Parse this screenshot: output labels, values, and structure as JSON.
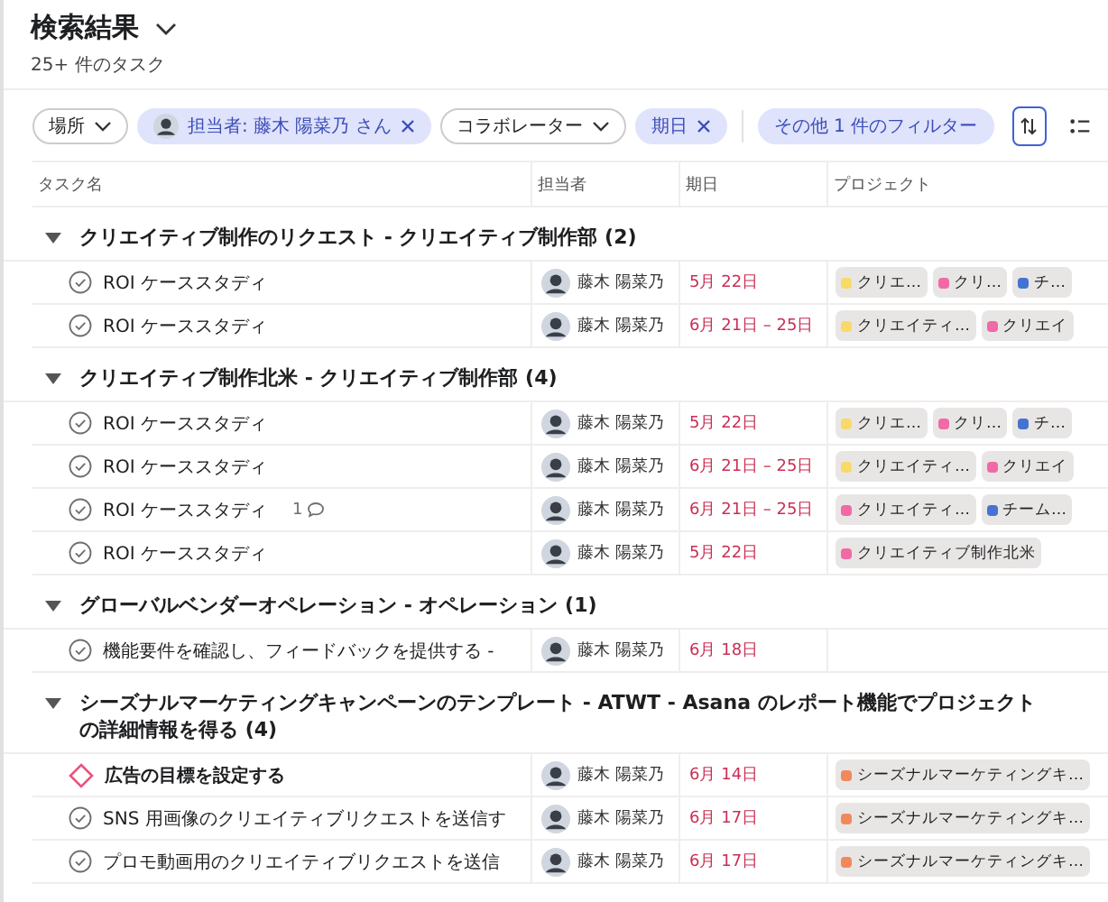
{
  "header": {
    "title": "検索結果",
    "subtitle": "25+ 件のタスク"
  },
  "filters": [
    {
      "kind": "dropdown",
      "label": "場所"
    },
    {
      "kind": "removable",
      "label": "担当者: 藤木 陽菜乃 さん",
      "avatar": true
    },
    {
      "kind": "dropdown",
      "label": "コラボレーター"
    },
    {
      "kind": "removable",
      "label": "期日",
      "avatar": false
    },
    {
      "kind": "more",
      "label": "その他 1 件のフィルター"
    }
  ],
  "columns": [
    "タスク名",
    "担当者",
    "期日",
    "プロジェクト"
  ],
  "sections": [
    {
      "title": "クリエイティブ制作のリクエスト - クリエイティブ制作部 (2)",
      "expanded": true,
      "rows": [
        {
          "kind": "task",
          "name": "ROI ケーススタディ",
          "assignee": "藤木 陽菜乃",
          "due": "5月 22日",
          "tags": [
            {
              "label": "クリエ…",
              "color": "#f8d96a"
            },
            {
              "label": "クリ…",
              "color": "#f06aa5"
            },
            {
              "label": "チ…",
              "color": "#4573d2"
            }
          ]
        },
        {
          "kind": "task",
          "name": "ROI ケーススタディ",
          "assignee": "藤木 陽菜乃",
          "due": "6月 21日 – 25日",
          "tags": [
            {
              "label": "クリエイティ…",
              "color": "#f8d96a"
            },
            {
              "label": "クリエイ",
              "color": "#f06aa5"
            }
          ]
        }
      ]
    },
    {
      "title": "クリエイティブ制作北米 - クリエイティブ制作部 (4)",
      "expanded": true,
      "rows": [
        {
          "kind": "task",
          "name": "ROI ケーススタディ",
          "assignee": "藤木 陽菜乃",
          "due": "5月 22日",
          "tags": [
            {
              "label": "クリエ…",
              "color": "#f8d96a"
            },
            {
              "label": "クリ…",
              "color": "#f06aa5"
            },
            {
              "label": "チ…",
              "color": "#4573d2"
            }
          ]
        },
        {
          "kind": "task",
          "name": "ROI ケーススタディ",
          "assignee": "藤木 陽菜乃",
          "due": "6月 21日 – 25日",
          "tags": [
            {
              "label": "クリエイティ…",
              "color": "#f8d96a"
            },
            {
              "label": "クリエイ",
              "color": "#f06aa5"
            }
          ]
        },
        {
          "kind": "task",
          "name": "ROI  ケーススタディ",
          "comments": "1",
          "assignee": "藤木 陽菜乃",
          "due": "6月 21日 – 25日",
          "tags": [
            {
              "label": "クリエイティ…",
              "color": "#f06aa5"
            },
            {
              "label": "チーム…",
              "color": "#4573d2"
            }
          ]
        },
        {
          "kind": "task",
          "name": "ROI  ケーススタディ",
          "assignee": "藤木 陽菜乃",
          "due": "5月 22日",
          "tags": [
            {
              "label": "クリエイティブ制作北米",
              "color": "#f06aa5"
            }
          ]
        }
      ]
    },
    {
      "title": "グローバルベンダーオペレーション - オペレーション (1)",
      "expanded": true,
      "rows": [
        {
          "kind": "task",
          "name": "機能要件を確認し、フィードバックを提供する -",
          "assignee": "藤木 陽菜乃",
          "due": "6月 18日",
          "tags": []
        }
      ]
    },
    {
      "title": "シーズナルマーケティングキャンペーンのテンプレート - ATWT - Asana のレポート機能でプロジェクトの詳細情報を得る (4)",
      "expanded": true,
      "rows": [
        {
          "kind": "milestone",
          "name": "広告の目標を設定する",
          "assignee": "藤木 陽菜乃",
          "due": "6月 14日",
          "tags": [
            {
              "label": "シーズナルマーケティングキ…",
              "color": "#f1895c"
            }
          ]
        },
        {
          "kind": "task",
          "name": "SNS 用画像のクリエイティブリクエストを送信す",
          "assignee": "藤木 陽菜乃",
          "due": "6月 17日",
          "tags": [
            {
              "label": "シーズナルマーケティングキ…",
              "color": "#f1895c"
            }
          ]
        },
        {
          "kind": "task",
          "name": "プロモ動画用のクリエイティブリクエストを送信",
          "assignee": "藤木 陽菜乃",
          "due": "6月 17日",
          "tags": [
            {
              "label": "シーズナルマーケティングキ…",
              "color": "#f1895c"
            }
          ]
        }
      ]
    }
  ]
}
